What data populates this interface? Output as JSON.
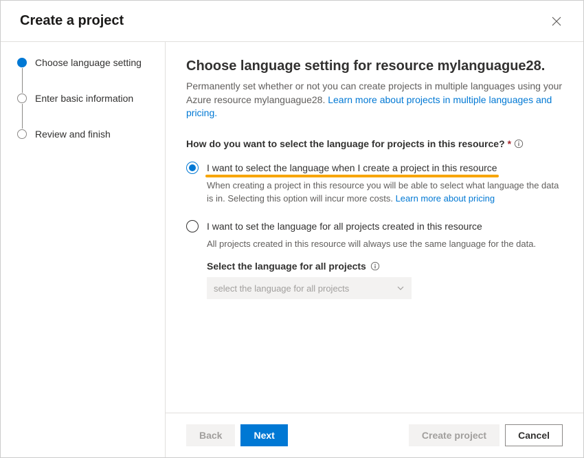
{
  "modal": {
    "title": "Create a project"
  },
  "sidebar": {
    "steps": [
      {
        "label": "Choose language setting"
      },
      {
        "label": "Enter basic information"
      },
      {
        "label": "Review and finish"
      }
    ]
  },
  "main": {
    "heading": "Choose language setting for resource mylanguague28.",
    "description_prefix": "Permanently set whether or not you can create projects in multiple languages using your Azure resource mylanguague28. ",
    "description_link": "Learn more about projects in multiple languages and pricing.",
    "question": "How do you want to select the language for projects in this resource?",
    "option1": {
      "label": "I want to select the language when I create a project in this resource",
      "desc_prefix": "When creating a project in this resource you will be able to select what language the data is in. Selecting this option will incur more costs. ",
      "desc_link": "Learn more about pricing"
    },
    "option2": {
      "label": "I want to set the language for all projects created in this resource",
      "desc": "All projects created in this resource will always use the same language for the data.",
      "select_label": "Select the language for all projects",
      "select_placeholder": "select the language for all projects"
    }
  },
  "footer": {
    "back": "Back",
    "next": "Next",
    "create": "Create project",
    "cancel": "Cancel"
  }
}
